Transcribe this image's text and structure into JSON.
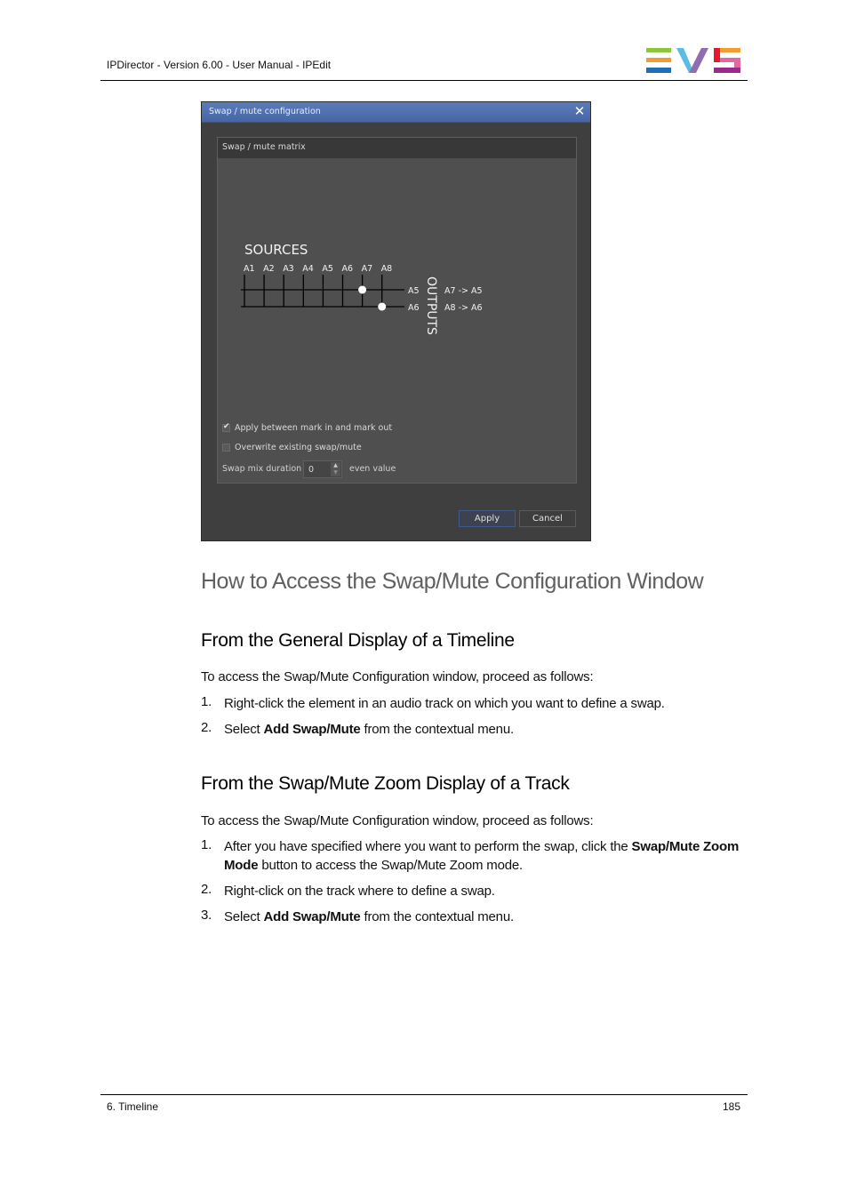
{
  "header": {
    "title": "IPDirector - Version 6.00 - User Manual - IPEdit",
    "logo": "EVS",
    "logo_colors": {
      "green": "#8cc63f",
      "orange": "#f39c34",
      "blue": "#1e6fb5",
      "lightblue": "#5bbce4",
      "purple": "#8f6db0",
      "red": "#e5192d",
      "pink": "#e06aa0",
      "magenta": "#9b2a8c"
    }
  },
  "dialog": {
    "title": "Swap / mute configuration",
    "close_icon": "close-icon",
    "groupbox_title": "Swap / mute matrix",
    "matrix": {
      "sources_label": "SOURCES",
      "outputs_label": "OUTPUTS",
      "sources": [
        "A1",
        "A2",
        "A3",
        "A4",
        "A5",
        "A6",
        "A7",
        "A8"
      ],
      "outputs": [
        "A5",
        "A6"
      ],
      "connections": [
        {
          "source": "A7",
          "output": "A5"
        },
        {
          "source": "A8",
          "output": "A6"
        }
      ],
      "mappings": [
        {
          "source": "A7",
          "arrow": "->",
          "output": "A5"
        },
        {
          "source": "A8",
          "arrow": "->",
          "output": "A6"
        }
      ]
    },
    "options": {
      "apply_between_marks": {
        "label": "Apply between mark in and mark out",
        "checked": true
      },
      "overwrite_existing": {
        "label": "Overwrite existing swap/mute",
        "checked": false
      },
      "swap_mix_duration": {
        "label": "Swap mix duration",
        "value": "0",
        "hint": "even value"
      }
    },
    "buttons": {
      "apply": "Apply",
      "cancel": "Cancel"
    },
    "colors": {
      "titlebar": "#4f6fb0",
      "background": "#3f3f3f",
      "panel": "#4f4f4f"
    }
  },
  "content": {
    "main_heading": "How to Access the Swap/Mute Configuration Window",
    "section1": {
      "heading": "From the General Display of a Timeline",
      "intro": "To access the Swap/Mute Configuration window, proceed as follows:",
      "steps": [
        {
          "num": "1.",
          "pre": "Right-click the element in an audio track on which you want to define a swap.",
          "bold": "",
          "post": ""
        },
        {
          "num": "2.",
          "pre": "Select ",
          "bold": "Add Swap/Mute",
          "post": " from the contextual menu."
        }
      ]
    },
    "section2": {
      "heading": "From the Swap/Mute Zoom Display of a Track",
      "intro": "To access the Swap/Mute Configuration window, proceed as follows:",
      "steps": [
        {
          "num": "1.",
          "pre": "After you have specified where you want to perform the swap, click the ",
          "bold": "Swap/Mute Zoom Mode",
          "post": " button to access the Swap/Mute Zoom mode."
        },
        {
          "num": "2.",
          "pre": "Right-click on the track where to define a swap.",
          "bold": "",
          "post": ""
        },
        {
          "num": "3.",
          "pre": "Select ",
          "bold": "Add Swap/Mute",
          "post": " from the contextual menu."
        }
      ]
    }
  },
  "footer": {
    "chapter": "6. Timeline",
    "page_number": "185"
  }
}
